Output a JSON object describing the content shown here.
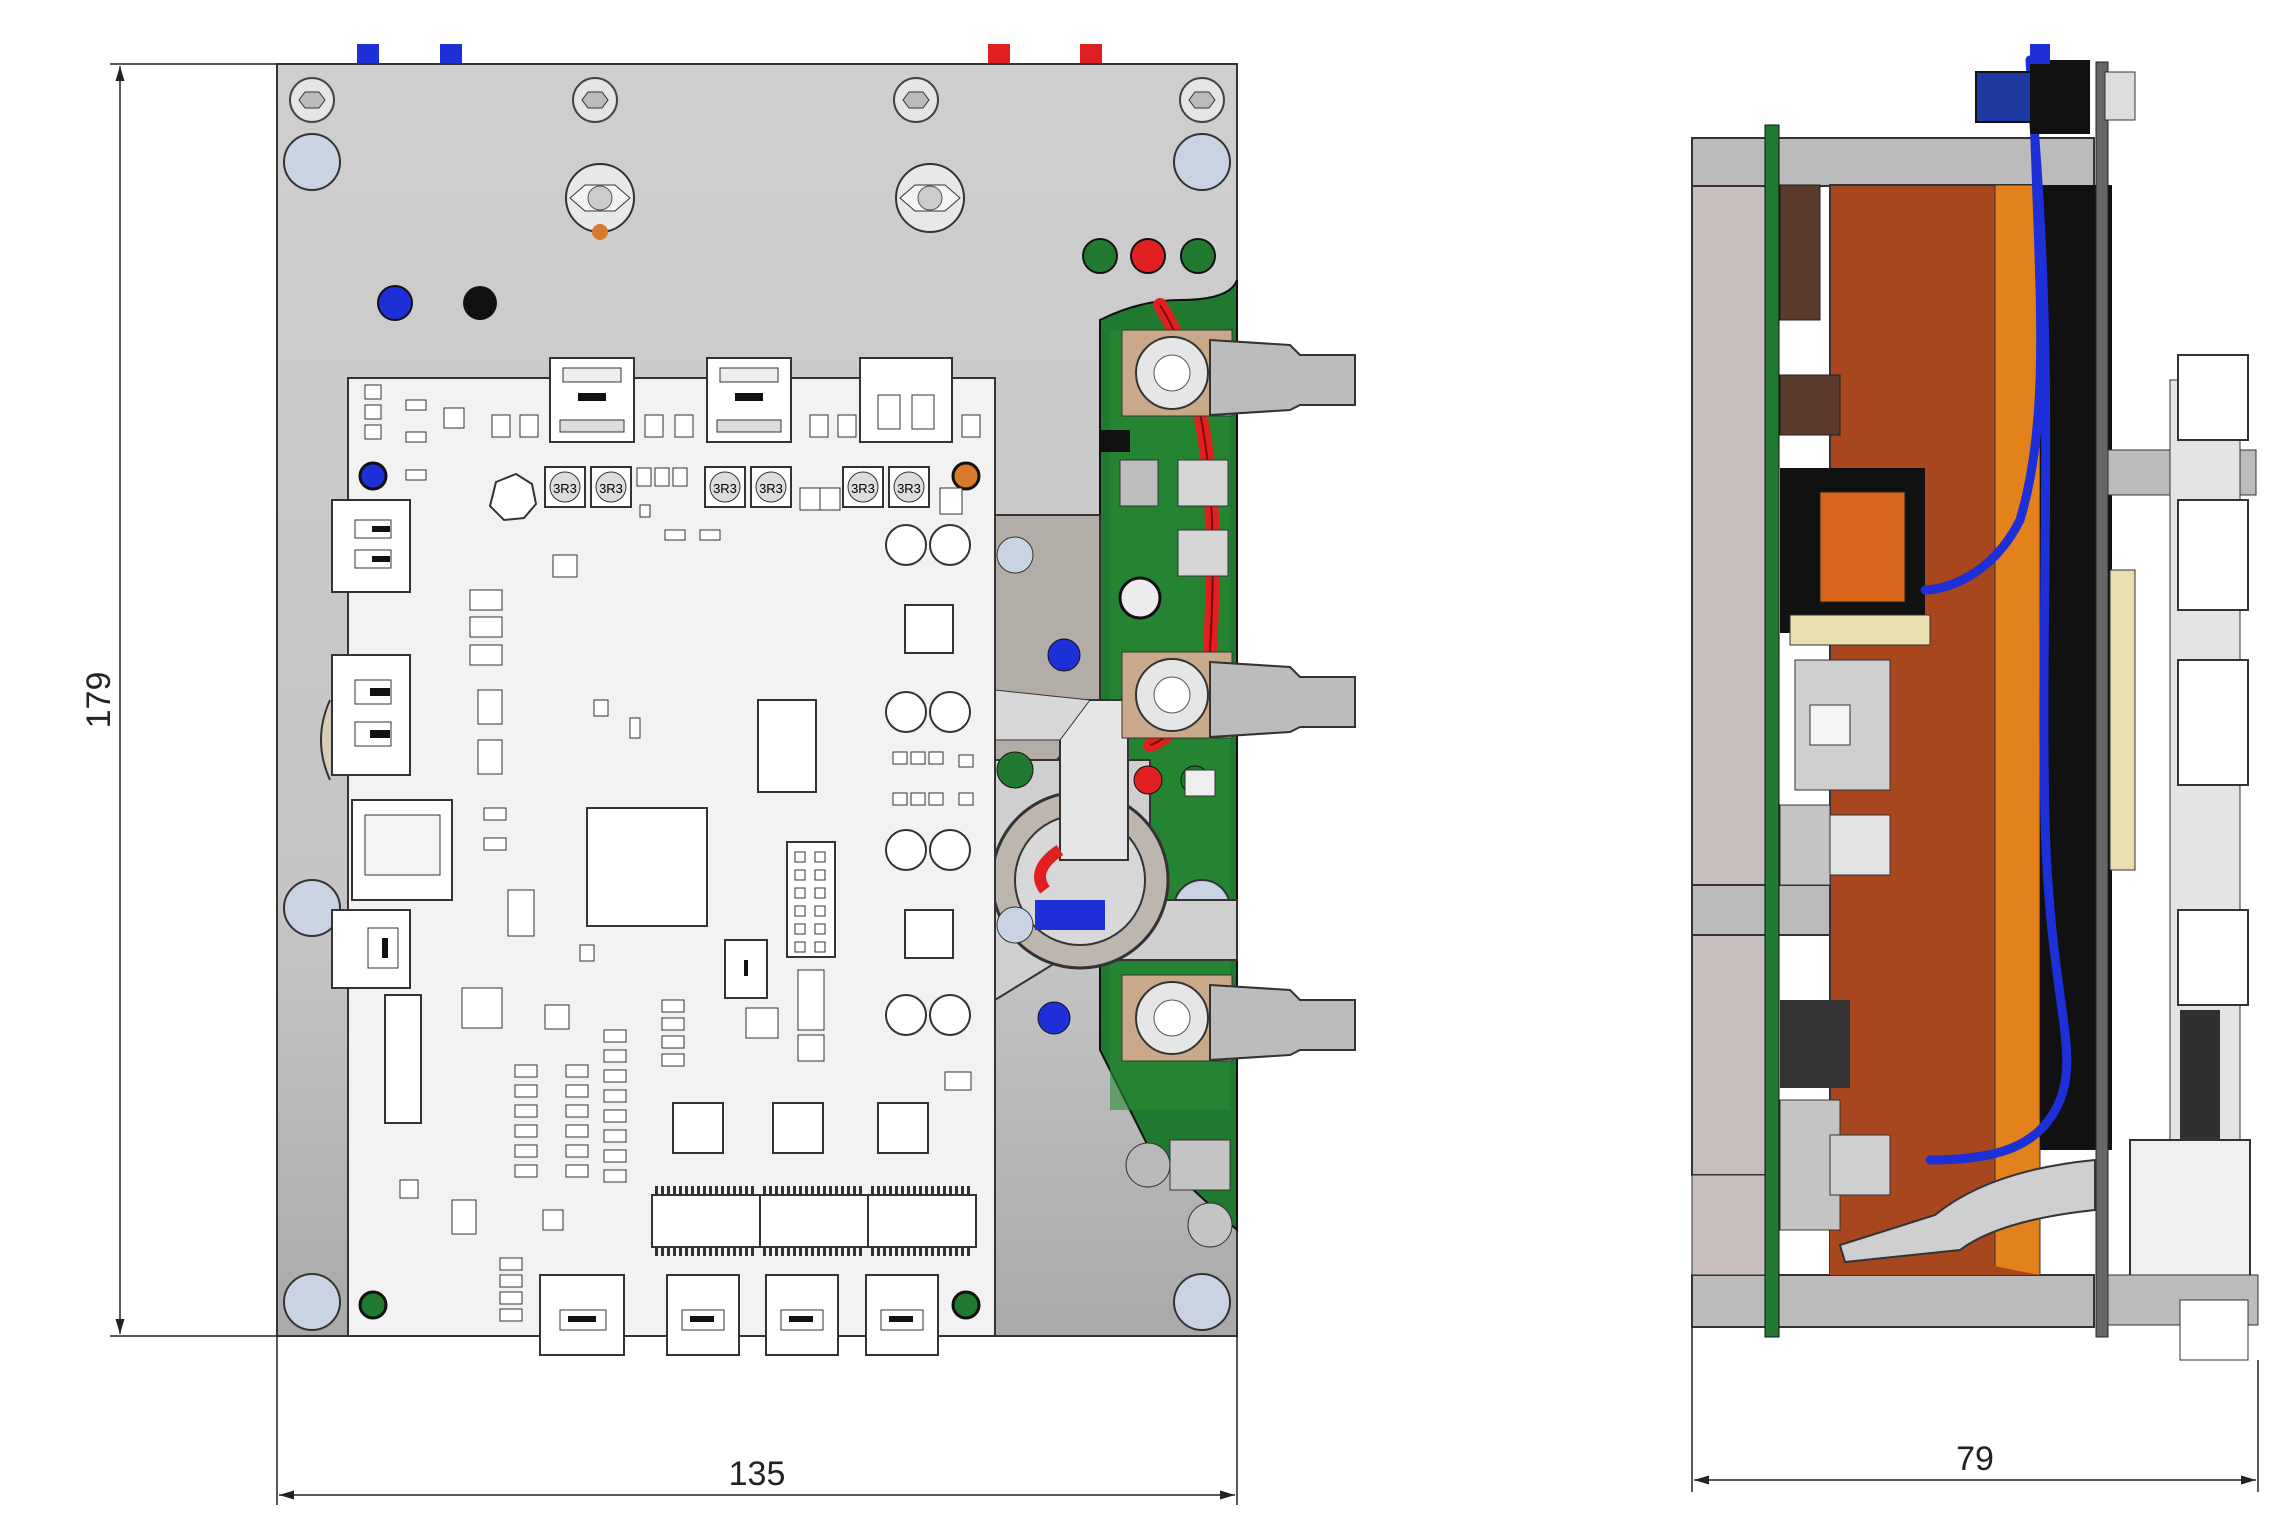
{
  "dimensions": {
    "height": "179",
    "width": "135",
    "depth": "79"
  },
  "board_labels": {
    "inductor_1": "3R3",
    "inductor_2": "3R3",
    "inductor_3": "3R3",
    "inductor_4": "3R3",
    "inductor_5": "3R3",
    "inductor_6": "3R3"
  },
  "colors": {
    "plate_grey": "#c8c8c8",
    "pcb_white": "#f2f2f2",
    "pcb_green": "#1f7a2f",
    "wire_red": "#e02020",
    "wire_blue": "#1d2fd6",
    "core_copper": "#a8461e",
    "core_orange": "#e3821c"
  }
}
